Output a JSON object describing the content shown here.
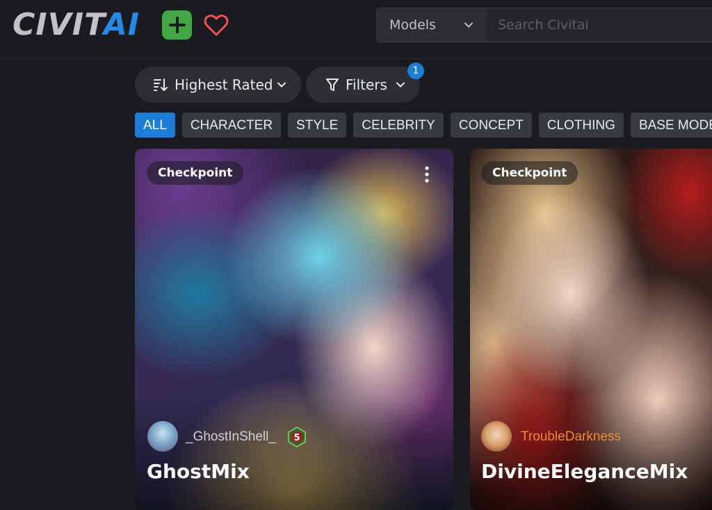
{
  "header": {
    "logo": {
      "part1": "CIVIT",
      "part2": "AI"
    },
    "search": {
      "category": "Models",
      "placeholder": "Search Civitai"
    }
  },
  "toolbar": {
    "sort_label": "Highest Rated",
    "filter_label": "Filters",
    "filter_count": "1"
  },
  "tags": [
    "ALL",
    "CHARACTER",
    "STYLE",
    "CELEBRITY",
    "CONCEPT",
    "CLOTHING",
    "BASE MODEL"
  ],
  "active_tag": "ALL",
  "cards": [
    {
      "type": "Checkpoint",
      "username": "_GhostInShell_",
      "rank": "5",
      "name": "GhostMix"
    },
    {
      "type": "Checkpoint",
      "username": "TroubleDarkness",
      "name": "DivineEleganceMix"
    }
  ],
  "colors": {
    "background": "#1a1b1e",
    "accent_blue": "#1c7ed6",
    "create_green": "#40a744",
    "heart_red": "#fa5252",
    "username_orange": "#f08c2e"
  }
}
